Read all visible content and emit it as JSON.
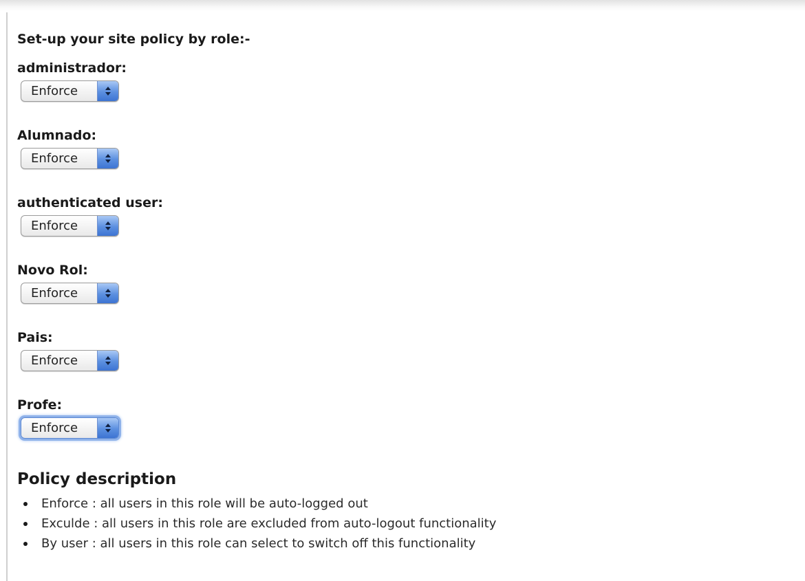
{
  "heading": "Set-up your site policy by role:-",
  "roles": [
    {
      "label": "administrador:",
      "selected": "Enforce"
    },
    {
      "label": "Alumnado:",
      "selected": "Enforce"
    },
    {
      "label": "authenticated user:",
      "selected": "Enforce"
    },
    {
      "label": "Novo Rol:",
      "selected": "Enforce"
    },
    {
      "label": "Pais:",
      "selected": "Enforce"
    },
    {
      "label": "Profe:",
      "selected": "Enforce"
    }
  ],
  "policy": {
    "title": "Policy description",
    "items": [
      "Enforce : all users in this role will be auto-logged out",
      "Exculde : all users in this role are excluded from auto-logout functionality",
      "By user : all users in this role can select to switch off this functionality"
    ]
  },
  "colors": {
    "select_arrow": "#5b8fe0",
    "focus_ring": "#8fb2ea"
  },
  "icons": {
    "select_arrow": "up-down-chevron-icon",
    "bullet": "bullet-dot-icon"
  }
}
